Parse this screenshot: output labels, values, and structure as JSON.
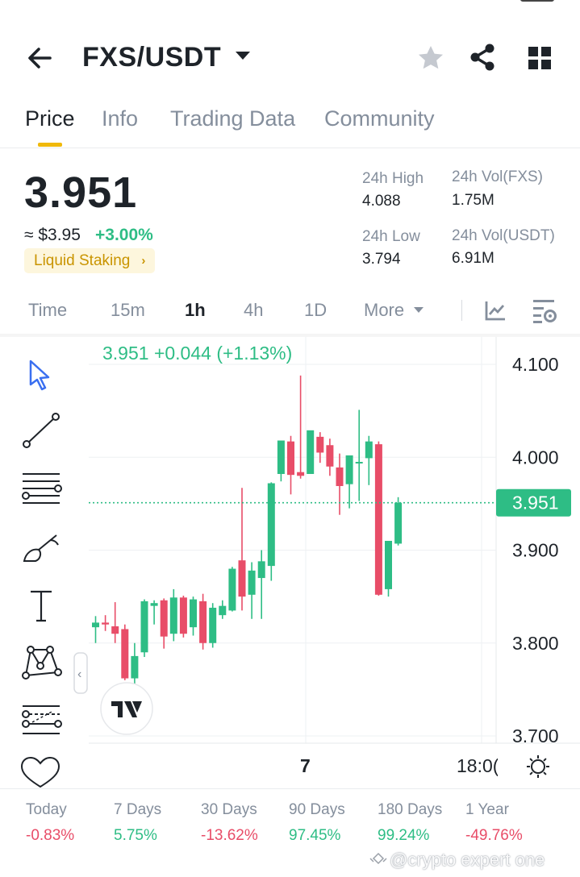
{
  "header": {
    "pair": "FXS/USDT",
    "icons": {
      "back": "arrow-left-icon",
      "dropdown": "caret-down-icon",
      "favorite": "star-icon",
      "share": "share-icon",
      "more": "grid-icon"
    }
  },
  "tabs": [
    {
      "label": "Price",
      "active": true
    },
    {
      "label": "Info",
      "active": false
    },
    {
      "label": "Trading Data",
      "active": false
    },
    {
      "label": "Community",
      "active": false
    }
  ],
  "price": {
    "last": "3.951",
    "usd": "≈ $3.95",
    "change": "+3.00%",
    "tag": "Liquid Staking",
    "tag_chevron": "›"
  },
  "stats": {
    "high_label": "24h High",
    "high_value": "4.088",
    "low_label": "24h Low",
    "low_value": "3.794",
    "vol_base_label": "24h Vol(FXS)",
    "vol_base_value": "1.75M",
    "vol_quote_label": "24h Vol(USDT)",
    "vol_quote_value": "6.91M"
  },
  "timeframes": {
    "items": [
      {
        "label": "Time",
        "active": false
      },
      {
        "label": "15m",
        "active": false
      },
      {
        "label": "1h",
        "active": true
      },
      {
        "label": "4h",
        "active": false
      },
      {
        "label": "1D",
        "active": false
      },
      {
        "label": "More",
        "active": false
      }
    ]
  },
  "tools": [
    "cursor-icon",
    "trend-line-icon",
    "horizontal-lines-icon",
    "brush-icon",
    "text-icon",
    "pattern-icon",
    "fib-icon",
    "heart-icon"
  ],
  "chart": {
    "legend": "3.951  +0.044 (+1.13%)",
    "last_price_label": "3.951",
    "x_ticks": [
      "7",
      "18:0("
    ],
    "colors": {
      "up": "#2ebd85",
      "down": "#e84d68"
    }
  },
  "chart_data": {
    "type": "candlestick",
    "pair": "FXS/USDT",
    "interval": "1h",
    "ylim": [
      3.68,
      4.13
    ],
    "y_ticks": [
      "4.100",
      "4.000",
      "3.900",
      "3.800",
      "3.700"
    ],
    "x_ticks": [
      "7",
      "18:0("
    ],
    "last_price": 3.951,
    "candles": [
      {
        "o": 3.817,
        "h": 3.829,
        "l": 3.8,
        "c": 3.822
      },
      {
        "o": 3.822,
        "h": 3.83,
        "l": 3.813,
        "c": 3.82
      },
      {
        "o": 3.818,
        "h": 3.844,
        "l": 3.8,
        "c": 3.81
      },
      {
        "o": 3.815,
        "h": 3.82,
        "l": 3.76,
        "c": 3.762
      },
      {
        "o": 3.762,
        "h": 3.8,
        "l": 3.755,
        "c": 3.786
      },
      {
        "o": 3.79,
        "h": 3.847,
        "l": 3.785,
        "c": 3.845
      },
      {
        "o": 3.84,
        "h": 3.846,
        "l": 3.82,
        "c": 3.843
      },
      {
        "o": 3.846,
        "h": 3.848,
        "l": 3.794,
        "c": 3.807
      },
      {
        "o": 3.81,
        "h": 3.858,
        "l": 3.802,
        "c": 3.849
      },
      {
        "o": 3.849,
        "h": 3.851,
        "l": 3.806,
        "c": 3.81
      },
      {
        "o": 3.817,
        "h": 3.85,
        "l": 3.808,
        "c": 3.847
      },
      {
        "o": 3.845,
        "h": 3.853,
        "l": 3.793,
        "c": 3.8
      },
      {
        "o": 3.8,
        "h": 3.843,
        "l": 3.795,
        "c": 3.838
      },
      {
        "o": 3.83,
        "h": 3.846,
        "l": 3.826,
        "c": 3.84
      },
      {
        "o": 3.835,
        "h": 3.882,
        "l": 3.834,
        "c": 3.88
      },
      {
        "o": 3.889,
        "h": 3.967,
        "l": 3.835,
        "c": 3.85
      },
      {
        "o": 3.852,
        "h": 3.887,
        "l": 3.826,
        "c": 3.878
      },
      {
        "o": 3.87,
        "h": 3.9,
        "l": 3.826,
        "c": 3.888
      },
      {
        "o": 3.883,
        "h": 3.973,
        "l": 3.867,
        "c": 3.972
      },
      {
        "o": 3.982,
        "h": 4.016,
        "l": 3.974,
        "c": 4.018
      },
      {
        "o": 4.017,
        "h": 4.023,
        "l": 3.96,
        "c": 3.981
      },
      {
        "o": 3.984,
        "h": 4.088,
        "l": 3.977,
        "c": 3.98
      },
      {
        "o": 3.982,
        "h": 4.017,
        "l": 3.985,
        "c": 4.029
      },
      {
        "o": 4.022,
        "h": 4.027,
        "l": 3.994,
        "c": 4.005
      },
      {
        "o": 4.013,
        "h": 4.02,
        "l": 3.98,
        "c": 3.99
      },
      {
        "o": 3.989,
        "h": 4.004,
        "l": 3.938,
        "c": 3.969
      },
      {
        "o": 3.971,
        "h": 4.001,
        "l": 3.945,
        "c": 4.002
      },
      {
        "o": 3.994,
        "h": 4.051,
        "l": 3.953,
        "c": 3.995
      },
      {
        "o": 3.999,
        "h": 4.023,
        "l": 3.97,
        "c": 4.017
      },
      {
        "o": 4.014,
        "h": 4.017,
        "l": 3.851,
        "c": 3.852
      },
      {
        "o": 3.858,
        "h": 3.877,
        "l": 3.85,
        "c": 3.91
      },
      {
        "o": 3.907,
        "h": 3.957,
        "l": 3.905,
        "c": 3.951
      }
    ]
  },
  "performance": [
    {
      "label": "Today",
      "value": "-0.83%",
      "color": "#e84d68"
    },
    {
      "label": "7 Days",
      "value": "5.75%",
      "color": "#2ebd85"
    },
    {
      "label": "30 Days",
      "value": "-13.62%",
      "color": "#e84d68"
    },
    {
      "label": "90 Days",
      "value": "97.45%",
      "color": "#2ebd85"
    },
    {
      "label": "180 Days",
      "value": "99.24%",
      "color": "#2ebd85"
    },
    {
      "label": "1 Year",
      "value": "-49.76%",
      "color": "#e84d68"
    }
  ],
  "watermark": "@crypto expert one"
}
